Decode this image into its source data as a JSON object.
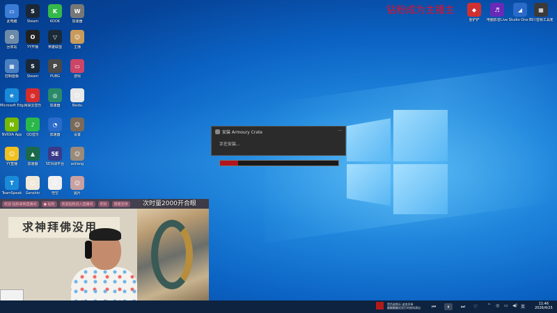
{
  "desktop": {
    "streamer_text": "钻粉成为主播主",
    "icons": [
      {
        "label": "此电脑",
        "color": "#3a7bd5",
        "glyph": "▭"
      },
      {
        "label": "Steam",
        "color": "#1b2838",
        "glyph": "S"
      },
      {
        "label": "KOOK",
        "color": "#35b94a",
        "glyph": "K"
      },
      {
        "label": "加速器",
        "color": "#777777",
        "glyph": "W"
      },
      {
        "label": "回收站",
        "color": "#6d8aa8",
        "glyph": "♻"
      },
      {
        "label": "YY开播",
        "color": "#222222",
        "glyph": "O"
      },
      {
        "label": "英雄联盟",
        "color": "#1a2a38",
        "glyph": "▽"
      },
      {
        "label": "主播",
        "color": "#c99b5a",
        "glyph": "☺"
      },
      {
        "label": "控制面板",
        "color": "#4a80c0",
        "glyph": "▦"
      },
      {
        "label": "Steam",
        "color": "#1b2838",
        "glyph": "S"
      },
      {
        "label": "PUBG",
        "color": "#4a4a4a",
        "glyph": "P"
      },
      {
        "label": "游戏",
        "color": "#cc4466",
        "glyph": "▭"
      },
      {
        "label": "Microsoft Edge",
        "color": "#1a8ad8",
        "glyph": "e"
      },
      {
        "label": "网易云音乐",
        "color": "#d72c2c",
        "glyph": "◎"
      },
      {
        "label": "加速器",
        "color": "#2a8a6a",
        "glyph": "◎"
      },
      {
        "label": "Baidu",
        "color": "#e8e8e8",
        "glyph": "☺"
      },
      {
        "label": "NVIDIA App",
        "color": "#76b900",
        "glyph": "N"
      },
      {
        "label": "QQ音乐",
        "color": "#2ab84a",
        "glyph": "♪"
      },
      {
        "label": "加速器",
        "color": "#2a6ac8",
        "glyph": "◔"
      },
      {
        "label": "设置",
        "color": "#7a6a5a",
        "glyph": "☺"
      },
      {
        "label": "YY直播",
        "color": "#f0c020",
        "glyph": "☺"
      },
      {
        "label": "加速器",
        "color": "#1a6a4a",
        "glyph": "▲"
      },
      {
        "label": "5E对战平台",
        "color": "#3a3a8a",
        "glyph": "5E"
      },
      {
        "label": "anliang",
        "color": "#9a8a7a",
        "glyph": "☺"
      },
      {
        "label": "TeamSpeak",
        "color": "#1a8ad8",
        "glyph": "T"
      },
      {
        "label": "Genshin",
        "color": "#f0e8d8",
        "glyph": "☺"
      },
      {
        "label": "悟空",
        "color": "#f0f0f0",
        "glyph": "☺"
      },
      {
        "label": "图片",
        "color": "#c8a0a0",
        "glyph": "☺"
      }
    ],
    "right_icons": [
      {
        "label": "金铲铲",
        "color": "#d03030",
        "glyph": "◆"
      },
      {
        "label": "电脑影音Live",
        "color": "#6a2ab8",
        "glyph": "♬"
      },
      {
        "label": "Studio One 7",
        "color": "#2a6ac8",
        "glyph": "◢"
      },
      {
        "label": "四川音频工具箱",
        "color": "#3a3a3a",
        "glyph": "▦"
      }
    ]
  },
  "installer": {
    "title": "安装 Armoury Crate",
    "status": "正在安装...",
    "progress_percent": 15
  },
  "overlay": {
    "banner": "求神拜佛没用",
    "top_text": "次时量2000开合眼",
    "bar_items": [
      "欢迎  钻粉来到直播间",
      "● 钻粉",
      "欢迎钻粉进入直播间",
      "你好",
      "感谢支持"
    ]
  },
  "taskbar": {
    "music_title": "黑色星期天-波浪吊带",
    "music_subtitle": "翻翻翻翻双双打的夜场演出",
    "time": "11:46",
    "date": "2026/4/25",
    "ime": "英"
  }
}
